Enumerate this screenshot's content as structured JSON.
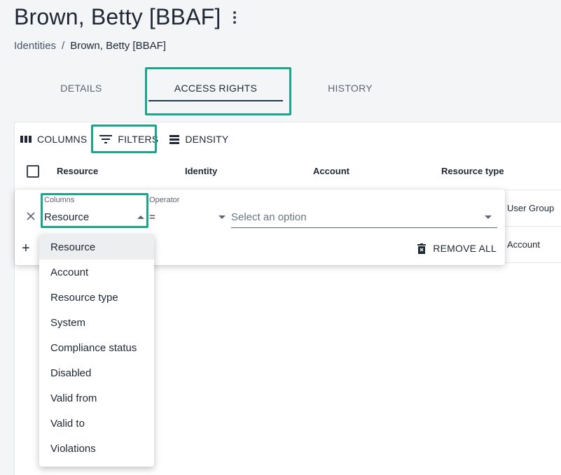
{
  "page": {
    "title": "Brown, Betty [BBAF]"
  },
  "breadcrumb": {
    "root": "Identities",
    "separator": "/",
    "current": "Brown, Betty [BBAF]"
  },
  "tabs": [
    {
      "label": "DETAILS"
    },
    {
      "label": "ACCESS RIGHTS",
      "active": true
    },
    {
      "label": "HISTORY"
    }
  ],
  "toolbar": {
    "columns_label": "COLUMNS",
    "filters_label": "FILTERS",
    "density_label": "DENSITY"
  },
  "table": {
    "headers": [
      "Resource",
      "Identity",
      "Account",
      "Resource type"
    ],
    "rows": [
      {
        "resource_type": "User Group"
      },
      {
        "resource_type": "Account"
      }
    ]
  },
  "filter_panel": {
    "columns_label": "Columns",
    "columns_value": "Resource",
    "operator_label": "Operator",
    "operator_value": "=",
    "value_placeholder": "Select an option",
    "remove_all_label": "REMOVE ALL",
    "add_symbol": "+"
  },
  "column_options": [
    "Resource",
    "Account",
    "Resource type",
    "System",
    "Compliance status",
    "Disabled",
    "Valid from",
    "Valid to",
    "Violations"
  ],
  "colors": {
    "highlight": "#1aa68a",
    "tab_underline": "#1e3a4a",
    "background": "#f4f5f7"
  }
}
